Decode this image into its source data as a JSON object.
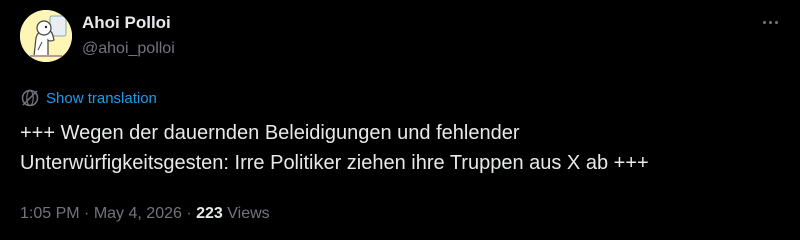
{
  "tweet": {
    "author": {
      "display_name": "Ahoi Polloi",
      "handle": "@ahoi_polloi",
      "avatar_icon": "cartoon-avatar"
    },
    "more_icon": "more-options-icon",
    "translate": {
      "label": "Show translation",
      "icon": "globe-translate-icon"
    },
    "text": "+++ Wegen der dauernden Beleidigungen und fehlender\nUnterwürfigkeitsgesten: Irre Politiker ziehen ihre Truppen aus X ab +++",
    "meta": {
      "time": "1:05 PM",
      "separator": "·",
      "date": "May 4, 2026",
      "views_count": "223",
      "views_label": "Views"
    }
  },
  "colors": {
    "background": "#000000",
    "primary_text": "#e7e9ea",
    "secondary_text": "#71767b",
    "accent": "#1d9bf0"
  }
}
